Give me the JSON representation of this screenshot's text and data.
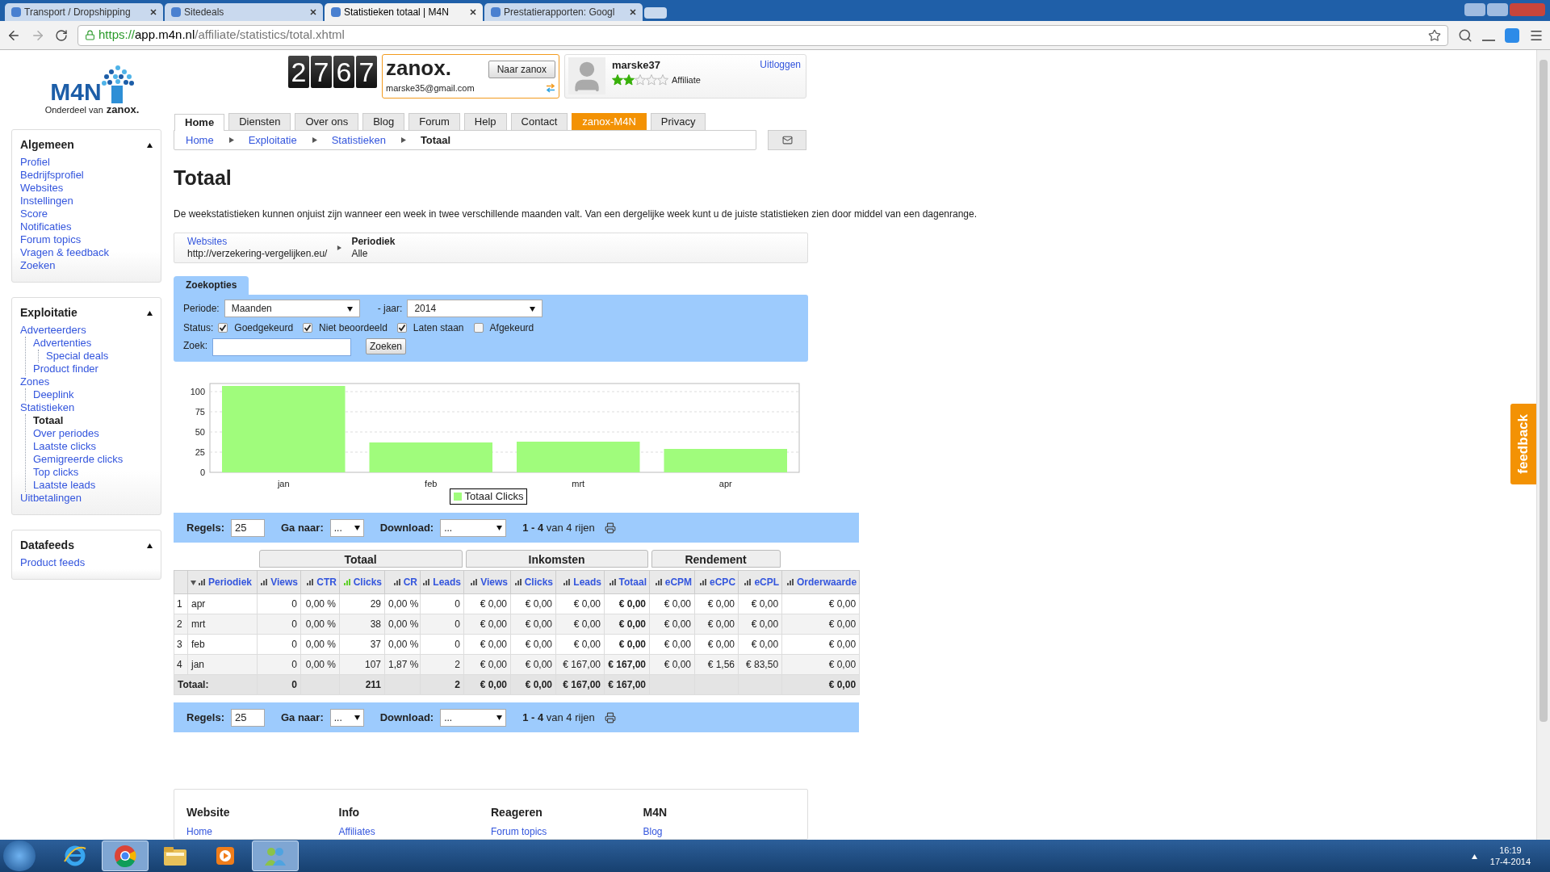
{
  "browser": {
    "tabs": [
      {
        "title": "Transport / Dropshipping",
        "selected": false
      },
      {
        "title": "Sitedeals",
        "selected": false
      },
      {
        "title": "Statistieken totaal | M4N",
        "selected": true
      },
      {
        "title": "Prestatierapporten: Googl",
        "selected": false
      }
    ],
    "url": {
      "scheme": "https://",
      "host": "app.m4n.nl",
      "path": "/affiliate/statistics/total.xhtml"
    }
  },
  "logo": {
    "name": "M4N",
    "tagline": "Onderdeel van",
    "brand": "zanox."
  },
  "counter": "2767",
  "zanox_box": {
    "brand": "zanox.",
    "button": "Naar zanox",
    "email": "marske35@gmail.com"
  },
  "user": {
    "name": "marske37",
    "stars": 2,
    "role": "Affiliate",
    "logout": "Uitloggen"
  },
  "sidebar": {
    "sections": [
      {
        "title": "Algemeen",
        "expanded": true,
        "items": [
          {
            "label": "Profiel",
            "selected": false
          },
          {
            "label": "Bedrijfsprofiel",
            "selected": false
          },
          {
            "label": "Websites",
            "selected": false
          },
          {
            "label": "Instellingen",
            "selected": false
          },
          {
            "label": "Score",
            "selected": false
          },
          {
            "label": "Notificaties",
            "selected": false
          },
          {
            "label": "Forum topics",
            "selected": false
          },
          {
            "label": "Vragen & feedback",
            "selected": false
          },
          {
            "label": "Zoeken",
            "selected": false
          }
        ]
      },
      {
        "title": "Exploitatie",
        "expanded": true,
        "items": [
          {
            "label": "Adverteerders",
            "selected": false,
            "children": [
              {
                "label": "Advertenties",
                "selected": false,
                "children": [
                  {
                    "label": "Special deals",
                    "selected": false
                  }
                ]
              },
              {
                "label": "Product finder",
                "selected": false
              }
            ]
          },
          {
            "label": "Zones",
            "selected": false,
            "children": [
              {
                "label": "Deeplink",
                "selected": false
              }
            ]
          },
          {
            "label": "Statistieken",
            "selected": false,
            "children": [
              {
                "label": "Totaal",
                "selected": true
              },
              {
                "label": "Over periodes",
                "selected": false
              },
              {
                "label": "Laatste clicks",
                "selected": false
              },
              {
                "label": "Gemigreerde clicks",
                "selected": false
              },
              {
                "label": "Top clicks",
                "selected": false
              },
              {
                "label": "Laatste leads",
                "selected": false
              }
            ]
          },
          {
            "label": "Uitbetalingen",
            "selected": false
          }
        ]
      },
      {
        "title": "Datafeeds",
        "expanded": true,
        "items": [
          {
            "label": "Product feeds",
            "selected": false
          }
        ]
      }
    ]
  },
  "nav_tabs": [
    {
      "label": "Home",
      "selected": true,
      "highlighted": false
    },
    {
      "label": "Diensten",
      "selected": false,
      "highlighted": false
    },
    {
      "label": "Over ons",
      "selected": false,
      "highlighted": false
    },
    {
      "label": "Blog",
      "selected": false,
      "highlighted": false
    },
    {
      "label": "Forum",
      "selected": false,
      "highlighted": false
    },
    {
      "label": "Help",
      "selected": false,
      "highlighted": false
    },
    {
      "label": "Contact",
      "selected": false,
      "highlighted": false
    },
    {
      "label": "zanox-M4N",
      "selected": false,
      "highlighted": true
    },
    {
      "label": "Privacy",
      "selected": false,
      "highlighted": false
    }
  ],
  "breadcrumbs": [
    {
      "label": "Home",
      "current": false
    },
    {
      "label": "Exploitatie",
      "current": false
    },
    {
      "label": "Statistieken",
      "current": false
    },
    {
      "label": "Totaal",
      "current": true
    }
  ],
  "title": "Totaal",
  "notice": "De weekstatistieken kunnen onjuist zijn wanneer een week in twee verschillende maanden valt. Van een dergelijke week kunt u de juiste statistieken zien door middel van een dagenrange.",
  "filter_path": [
    {
      "label": "Websites",
      "value": "http://verzekering-vergelijken.eu/",
      "link": true
    },
    {
      "label": "Periodiek",
      "value": "Alle",
      "link": false
    }
  ],
  "search_options": {
    "tab": "Zoekopties",
    "period_label": "Periode:",
    "period": "Maanden",
    "year_label": "- jaar:",
    "year": "2014",
    "status_label": "Status:",
    "statuses": [
      {
        "label": "Goedgekeurd",
        "checked": true
      },
      {
        "label": "Niet beoordeeld",
        "checked": true
      },
      {
        "label": "Laten staan",
        "checked": true
      },
      {
        "label": "Afgekeurd",
        "checked": false
      }
    ],
    "search_label": "Zoek:",
    "search_button": "Zoeken"
  },
  "chart_data": {
    "type": "bar",
    "categories": [
      "jan",
      "feb",
      "mrt",
      "apr"
    ],
    "series": [
      {
        "name": "Totaal Clicks",
        "color": "#a0fc7c",
        "values": [
          107,
          37,
          38,
          29
        ]
      }
    ],
    "ylim": [
      0,
      110
    ],
    "grid": true,
    "yticks": [
      0,
      25,
      50,
      75,
      100
    ]
  },
  "pagers": [
    {
      "rows_label": "Regels:",
      "rows": "25",
      "goto_label": "Ga naar:",
      "goto": "...",
      "download_label": "Download:",
      "download": "...",
      "range": "**1 - 4** van 4 rijen"
    },
    {
      "rows_label": "Regels:",
      "rows": "25",
      "goto_label": "Ga naar:",
      "goto": "...",
      "download_label": "Download:",
      "download": "...",
      "range": "**1 - 4** van 4 rijen"
    }
  ],
  "table": {
    "groups": [
      {
        "columns": [
          {
            "label": "Periodiek",
            "sorted": true,
            "charted": false,
            "emphasis": false
          }
        ]
      },
      {
        "label": "Totaal",
        "columns": [
          {
            "label": "Views",
            "sorted": false,
            "charted": false,
            "emphasis": false
          },
          {
            "label": "CTR",
            "sorted": false,
            "charted": false,
            "emphasis": false
          },
          {
            "label": "Clicks",
            "sorted": false,
            "charted": true,
            "emphasis": false
          },
          {
            "label": "CR",
            "sorted": false,
            "charted": false,
            "emphasis": false
          },
          {
            "label": "Leads",
            "sorted": false,
            "charted": false,
            "emphasis": false
          }
        ]
      },
      {
        "label": "Inkomsten",
        "columns": [
          {
            "label": "Views",
            "sorted": false,
            "charted": false,
            "emphasis": false
          },
          {
            "label": "Clicks",
            "sorted": false,
            "charted": false,
            "emphasis": false
          },
          {
            "label": "Leads",
            "sorted": false,
            "charted": false,
            "emphasis": false
          },
          {
            "label": "Totaal",
            "sorted": false,
            "charted": false,
            "emphasis": true
          }
        ]
      },
      {
        "label": "Rendement",
        "columns": [
          {
            "label": "eCPM",
            "sorted": false,
            "charted": false,
            "emphasis": false
          },
          {
            "label": "eCPC",
            "sorted": false,
            "charted": false,
            "emphasis": false
          },
          {
            "label": "eCPL",
            "sorted": false,
            "charted": false,
            "emphasis": false
          }
        ]
      },
      {
        "columns": [
          {
            "label": "Orderwaarde",
            "sorted": false,
            "charted": false,
            "emphasis": false
          }
        ]
      }
    ],
    "rows": [
      {
        "index": "1",
        "cells": [
          "apr",
          "0",
          "0,00 %",
          "29",
          "0,00 %",
          "0",
          "€ 0,00",
          "€ 0,00",
          "€ 0,00",
          "€ 0,00",
          "€ 0,00",
          "€ 0,00",
          "€ 0,00",
          "€ 0,00"
        ]
      },
      {
        "index": "2",
        "cells": [
          "mrt",
          "0",
          "0,00 %",
          "38",
          "0,00 %",
          "0",
          "€ 0,00",
          "€ 0,00",
          "€ 0,00",
          "€ 0,00",
          "€ 0,00",
          "€ 0,00",
          "€ 0,00",
          "€ 0,00"
        ]
      },
      {
        "index": "3",
        "cells": [
          "feb",
          "0",
          "0,00 %",
          "37",
          "0,00 %",
          "0",
          "€ 0,00",
          "€ 0,00",
          "€ 0,00",
          "€ 0,00",
          "€ 0,00",
          "€ 0,00",
          "€ 0,00",
          "€ 0,00"
        ]
      },
      {
        "index": "4",
        "cells": [
          "jan",
          "0",
          "0,00 %",
          "107",
          "1,87 %",
          "2",
          "€ 0,00",
          "€ 0,00",
          "€ 167,00",
          "€ 167,00",
          "€ 0,00",
          "€ 1,56",
          "€ 83,50",
          "€ 0,00"
        ]
      }
    ],
    "total": {
      "label": "Totaal:",
      "cells": [
        "0",
        null,
        "211",
        null,
        "2",
        "€ 0,00",
        "€ 0,00",
        "€ 167,00",
        "€ 167,00",
        null,
        null,
        null,
        "€ 0,00"
      ]
    }
  },
  "footer": [
    {
      "title": "Website",
      "link": "Home"
    },
    {
      "title": "Info",
      "link": "Affiliates"
    },
    {
      "title": "Reageren",
      "link": "Forum topics"
    },
    {
      "title": "M4N",
      "link": "Blog"
    }
  ],
  "feedback_tab": "feedback",
  "taskbar": {
    "apps": [
      {
        "kind": "ie",
        "selected": false
      },
      {
        "kind": "chrome",
        "selected": true
      },
      {
        "kind": "folder",
        "selected": false
      },
      {
        "kind": "media",
        "selected": false
      },
      {
        "kind": "people",
        "selected": true
      }
    ],
    "time": "16:19",
    "date": "17-4-2014"
  }
}
